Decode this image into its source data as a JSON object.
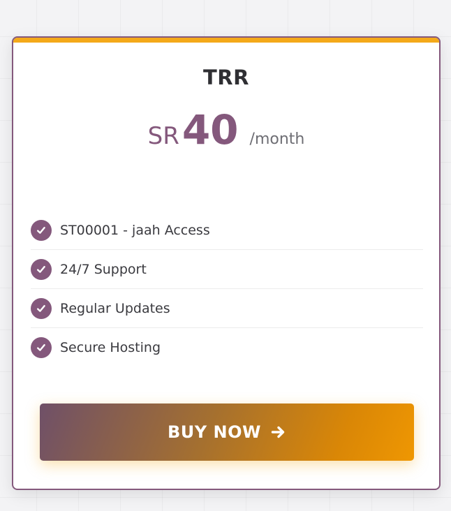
{
  "plan": {
    "title": "TRR",
    "currency": "SR",
    "amount": "40",
    "period": "/month"
  },
  "features": [
    {
      "label": "ST00001 - jaah Access",
      "icon": "check-circle-icon"
    },
    {
      "label": "24/7 Support",
      "icon": "check-circle-icon"
    },
    {
      "label": "Regular Updates",
      "icon": "check-circle-icon"
    },
    {
      "label": "Secure Hosting",
      "icon": "check-circle-icon"
    }
  ],
  "cta": {
    "label": "BUY NOW",
    "icon": "arrow-right-icon"
  },
  "colors": {
    "accent": "#84587c",
    "highlight": "#f4a91a",
    "button_gradient_start": "#6f5068",
    "button_gradient_end": "#ef9702"
  }
}
